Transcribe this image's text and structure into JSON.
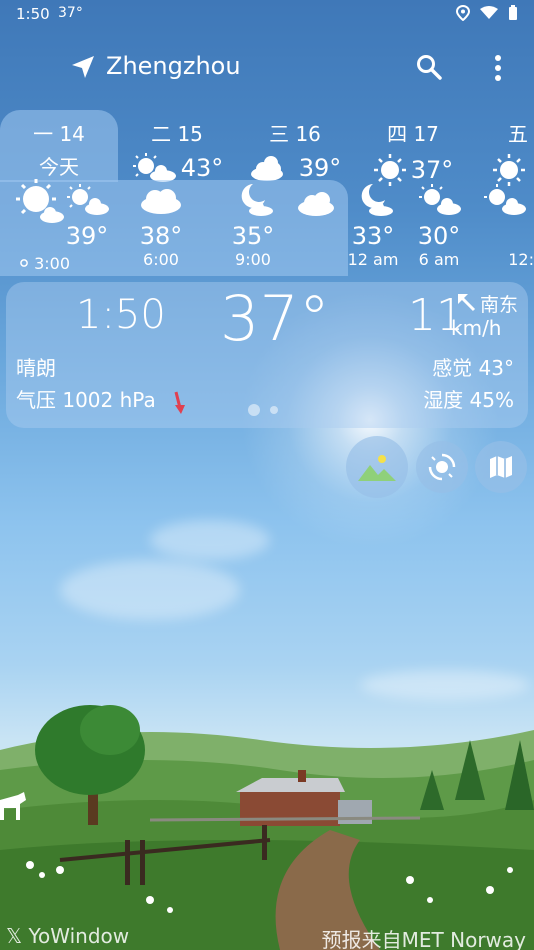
{
  "status_bar": {
    "time": "1:50",
    "temp_badge": "37°"
  },
  "header": {
    "city": "Zhengzhou"
  },
  "days": [
    {
      "label": "一 14",
      "sub": "今天",
      "active": true
    },
    {
      "label": "二 15",
      "temp": "43°",
      "icon": "sun-cloud"
    },
    {
      "label": "三 16",
      "temp": "39°",
      "icon": "sun-cloud"
    },
    {
      "label": "四 17",
      "temp": "37°",
      "icon": "sun"
    },
    {
      "label": "五",
      "icon": "sun"
    }
  ],
  "hourly": [
    {
      "temp": "",
      "time": "3:00",
      "icon": "sun-big"
    },
    {
      "temp": "39°",
      "time": "3:00",
      "icon": "sun-cloud"
    },
    {
      "temp": "38°",
      "time": "6:00",
      "icon": "cloud"
    },
    {
      "temp": "35°",
      "time": "9:00",
      "icon": "moon-cloud"
    },
    {
      "temp": "33°",
      "time": "12 am",
      "icon": "moon-cloud"
    },
    {
      "temp": "30°",
      "time": "6 am",
      "icon": "sun-cloud"
    },
    {
      "temp": "",
      "time": "12:",
      "icon": "sun-cloud"
    }
  ],
  "current": {
    "time": "1:50",
    "temperature": "37°",
    "wind_speed": "11",
    "wind_unit": "km/h",
    "wind_direction": "南东",
    "condition": "晴朗",
    "feels_like": "感觉 43°",
    "pressure": "气压 1002 hPa",
    "humidity": "湿度 45%"
  },
  "footer": {
    "brand": "YoWindow",
    "source": "预报来自MET Norway"
  },
  "colors": {
    "panel": "#a0c8f0",
    "accent_red": "#e04050"
  }
}
